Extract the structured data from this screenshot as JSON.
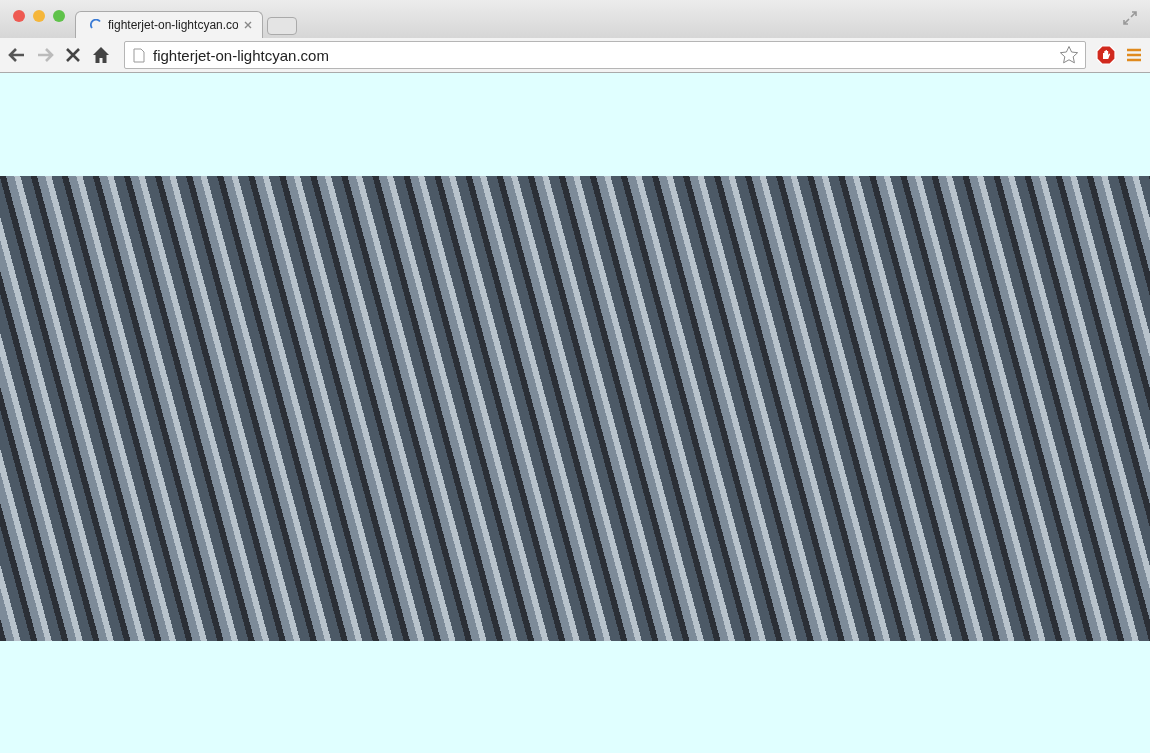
{
  "tabs": [
    {
      "title": "fighterjet-on-lightcyan.co",
      "selected": true
    }
  ],
  "nav_buttons": [
    {
      "kind": "back",
      "disabled": false
    },
    {
      "kind": "forward",
      "disabled": true
    },
    {
      "kind": "stop",
      "disabled": false
    },
    {
      "kind": "home",
      "disabled": false
    }
  ],
  "address_bar": {
    "value": "fighterjet-on-lightcyan.com"
  }
}
